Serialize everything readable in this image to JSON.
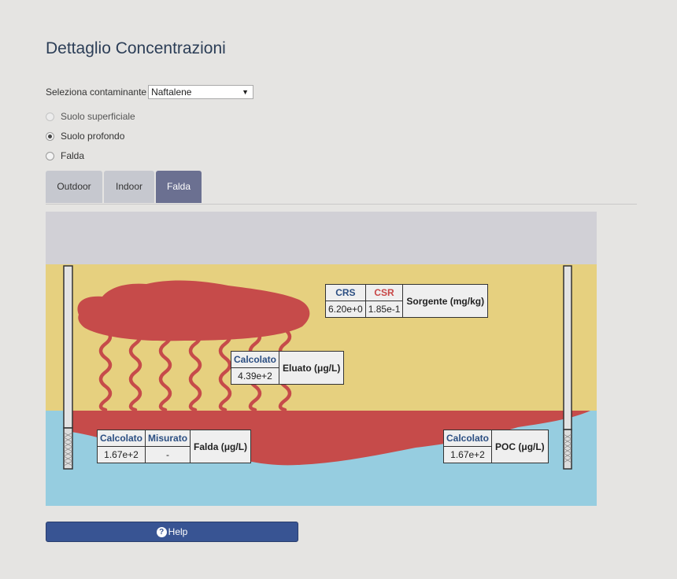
{
  "page": {
    "title": "Dettaglio Concentrazioni"
  },
  "selector": {
    "label": "Seleziona contaminante",
    "value": "Naftalene"
  },
  "radios": [
    {
      "label": "Suolo superficiale",
      "checked": false,
      "disabled": true
    },
    {
      "label": "Suolo profondo",
      "checked": true,
      "disabled": false
    },
    {
      "label": "Falda",
      "checked": false,
      "disabled": false
    }
  ],
  "tabs": [
    {
      "label": "Outdoor",
      "active": false
    },
    {
      "label": "Indoor",
      "active": false
    },
    {
      "label": "Falda",
      "active": true
    }
  ],
  "scene": {
    "colors": {
      "air": "#d1d0d6",
      "soil": "#e6d07f",
      "water": "#96cde0",
      "contaminant": "#c64b4a",
      "well": "#e3e3e3",
      "screen": "#dcdcdc"
    },
    "sorgente": {
      "crs_header": "CRS",
      "csr_header": "CSR",
      "crs_value": "6.20e+0",
      "csr_value": "1.85e-1",
      "label": "Sorgente (mg/kg)"
    },
    "eluato": {
      "calc_header": "Calcolato",
      "calc_value": "4.39e+2",
      "label": "Eluato (μg/L)"
    },
    "falda": {
      "calc_header": "Calcolato",
      "mis_header": "Misurato",
      "calc_value": "1.67e+2",
      "mis_value": "-",
      "label": "Falda (μg/L)"
    },
    "poc": {
      "calc_header": "Calcolato",
      "calc_value": "1.67e+2",
      "label": "POC (μg/L)"
    }
  },
  "help": {
    "label": "Help",
    "icon": "question-circle-icon"
  }
}
